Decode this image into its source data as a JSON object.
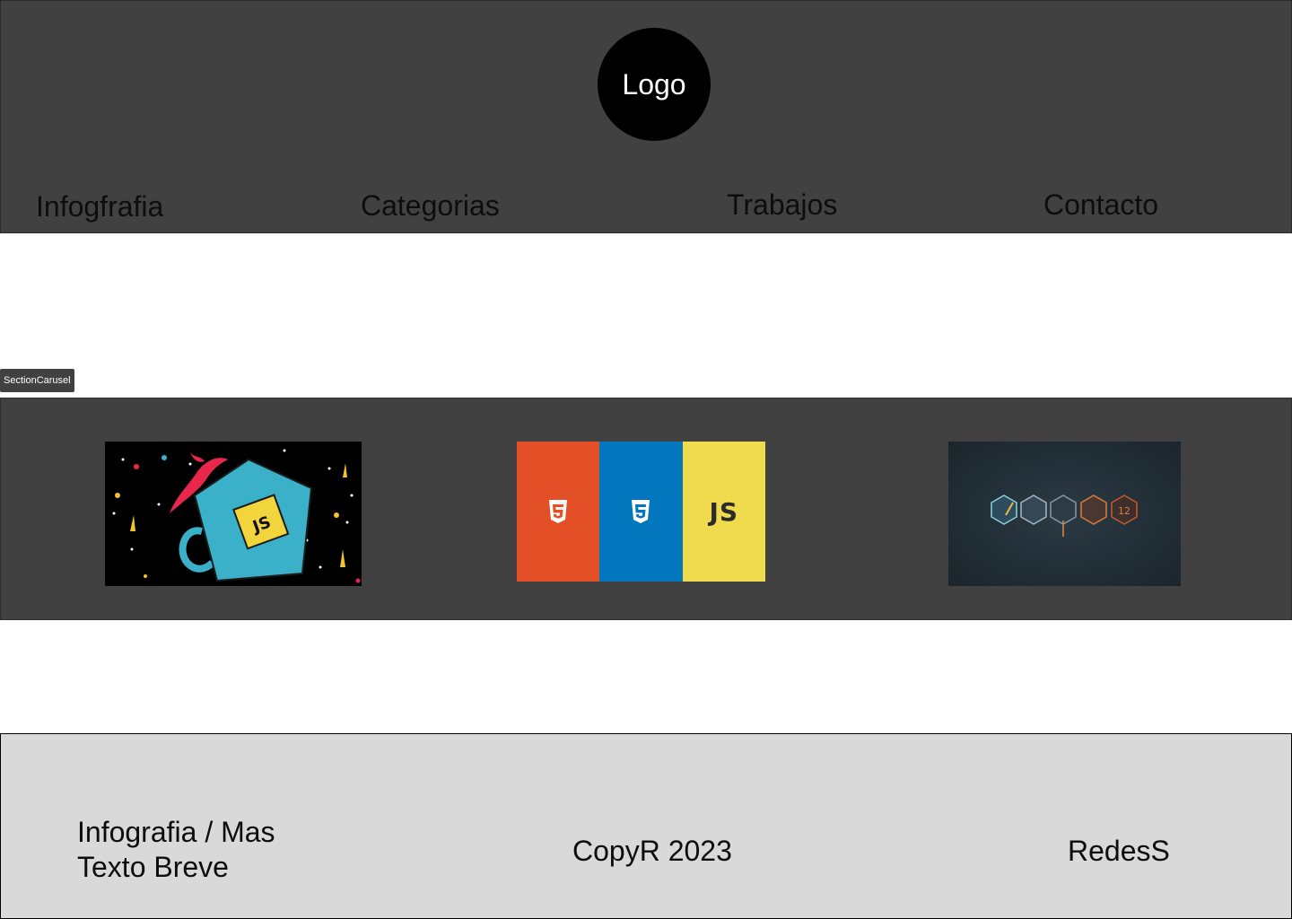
{
  "header": {
    "logo_label": "Logo",
    "nav": [
      {
        "label": "Infogfrafia"
      },
      {
        "label": "Categorias"
      },
      {
        "label": "Trabajos"
      },
      {
        "label": "Contacto"
      }
    ],
    "background": "#414141"
  },
  "section_label": "SectionCarusel",
  "carousel": {
    "slides": [
      {
        "name": "js-mug-illustration",
        "badge_text": "JS"
      },
      {
        "name": "html-css-js-banner",
        "panels": [
          {
            "color": "#e34f26",
            "icon": "html5-icon"
          },
          {
            "color": "#0277bd",
            "icon": "css3-icon"
          },
          {
            "color": "#f0db4f",
            "text": "JS"
          }
        ]
      },
      {
        "name": "hexagon-icons-banner",
        "badge_text": "12"
      }
    ]
  },
  "footer": {
    "info_line1": "Infografia / Mas",
    "info_line2": "Texto Breve",
    "copyright": "CopyR 2023",
    "social": "RedesS",
    "background": "#d9d9d9"
  }
}
